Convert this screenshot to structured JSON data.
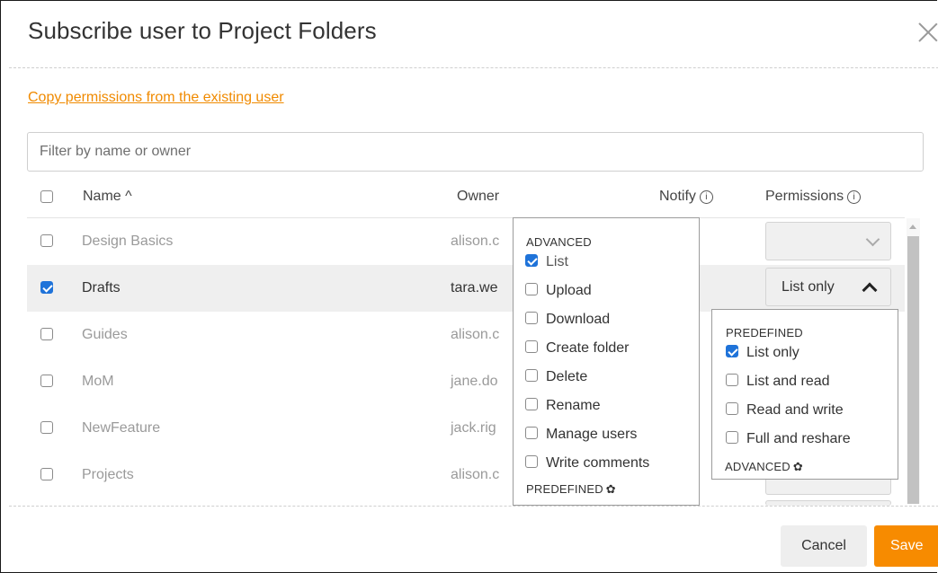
{
  "dialog": {
    "title": "Subscribe user to Project Folders",
    "copy_link": "Copy permissions from the existing user",
    "filter_placeholder": "Filter by name or owner"
  },
  "table": {
    "headers": {
      "name": "Name ^",
      "owner": "Owner",
      "notify": "Notify",
      "permissions": "Permissions",
      "info_glyph": "i"
    },
    "rows": [
      {
        "name": "Design Basics",
        "owner": "alison.c",
        "checked": false,
        "permission": ""
      },
      {
        "name": "Drafts",
        "owner": "tara.we",
        "checked": true,
        "permission": "List only"
      },
      {
        "name": "Guides",
        "owner": "alison.c",
        "checked": false,
        "permission": ""
      },
      {
        "name": "MoM",
        "owner": "jane.do",
        "checked": false,
        "permission": ""
      },
      {
        "name": "NewFeature",
        "owner": "jack.rig",
        "checked": false,
        "permission": ""
      },
      {
        "name": "Projects",
        "owner": "alison.c",
        "checked": false,
        "permission": ""
      }
    ]
  },
  "advanced_popup": {
    "heading": "ADVANCED",
    "items": [
      {
        "label": "List",
        "checked": true
      },
      {
        "label": "Upload",
        "checked": false
      },
      {
        "label": "Download",
        "checked": false
      },
      {
        "label": "Create folder",
        "checked": false
      },
      {
        "label": "Delete",
        "checked": false
      },
      {
        "label": "Rename",
        "checked": false
      },
      {
        "label": "Manage users",
        "checked": false
      },
      {
        "label": "Write comments",
        "checked": false
      }
    ],
    "footer": "PREDEFINED"
  },
  "predefined_popup": {
    "heading": "PREDEFINED",
    "items": [
      {
        "label": "List only",
        "checked": true
      },
      {
        "label": "List and read",
        "checked": false
      },
      {
        "label": "Read and write",
        "checked": false
      },
      {
        "label": "Full and reshare",
        "checked": false
      }
    ],
    "footer": "ADVANCED"
  },
  "footer": {
    "cancel": "Cancel",
    "save": "Save"
  },
  "colors": {
    "accent": "#f78b00",
    "link": "#f08a00",
    "checkbox": "#1f73d9"
  }
}
